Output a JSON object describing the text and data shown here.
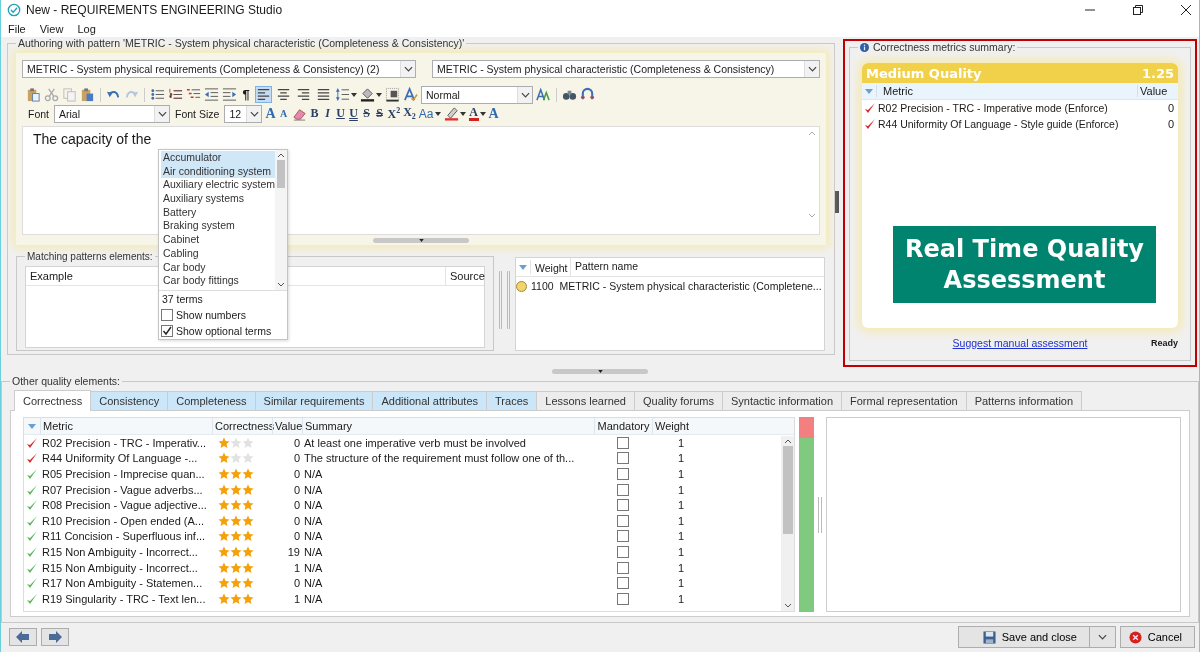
{
  "window": {
    "title": "New - REQUIREMENTS ENGINEERING Studio"
  },
  "menu": [
    "File",
    "View",
    "Log"
  ],
  "authoring": {
    "legend": "Authoring with pattern 'METRIC - System physical characteristic (Completeness & Consistency)'",
    "pattern_select": "METRIC - System physical requirements (Completeness & Consistency)  (2)",
    "characteristic_select": "METRIC - System physical characteristic (Completeness & Consistency)",
    "paragraph_mark": "¶",
    "alignment": [
      {
        "selected": true
      },
      {
        "selected": false
      },
      {
        "selected": false
      },
      {
        "selected": false
      }
    ],
    "style_select": "Normal",
    "font_label": "Font",
    "font_select": "Arial",
    "size_label": "Font Size",
    "size_select": "12",
    "format_buttons": [
      {
        "label": "A",
        "kind": "grow"
      },
      {
        "label": "A",
        "kind": "shrink"
      },
      {
        "label": "B",
        "kind": "bold"
      },
      {
        "label": "I",
        "kind": "italic"
      },
      {
        "label": "U",
        "kind": "underline"
      },
      {
        "label": "U",
        "kind": "double-underline"
      },
      {
        "label": "S",
        "kind": "strike"
      },
      {
        "label": "S",
        "kind": "double-strike"
      },
      {
        "label": "X$^{2}$",
        "kind": "super"
      },
      {
        "label": "X$_{2}$",
        "kind": "sub"
      },
      {
        "label": "Aa",
        "kind": "case"
      },
      {
        "label": "A",
        "kind": "color"
      },
      {
        "label": "A",
        "kind": "effect"
      }
    ],
    "text": "The capacity of the"
  },
  "suggestions": {
    "items": [
      {
        "label": "Accumulator",
        "selected": true
      },
      {
        "label": "Air conditioning system",
        "selected": true
      },
      {
        "label": "Auxiliary electric system",
        "selected": false
      },
      {
        "label": "Auxiliary systems",
        "selected": false
      },
      {
        "label": "Battery",
        "selected": false
      },
      {
        "label": "Braking system",
        "selected": false
      },
      {
        "label": "Cabinet",
        "selected": false
      },
      {
        "label": "Cabling",
        "selected": false
      },
      {
        "label": "Car body",
        "selected": false
      },
      {
        "label": "Car body fittings",
        "selected": false
      }
    ],
    "count": "37 terms",
    "options": [
      {
        "label": "Show numbers",
        "checked": false
      },
      {
        "label": "Show optional terms",
        "checked": true
      }
    ]
  },
  "matching": {
    "legend": "Matching patterns elements:",
    "columns": [
      "Example",
      "Source"
    ]
  },
  "patterns": {
    "columns": [
      "Weight",
      "Pattern name"
    ],
    "rows": [
      {
        "color": "#f3d36b",
        "weight": "1100",
        "name": "METRIC - System physical characteristic (Completene..."
      }
    ]
  },
  "summary": {
    "legend": "Correctness metrics summary:",
    "quality": "Medium Quality",
    "score": "1.25",
    "columns": [
      "Metric",
      "Value"
    ],
    "rows": [
      {
        "color": "#d42a2a",
        "metric": "R02 Precision - TRC - Imperative mode (Enforce)",
        "value": "0"
      },
      {
        "color": "#d42a2a",
        "metric": "R44 Uniformity Of Language - Style guide (Enforce)",
        "value": "0"
      }
    ],
    "banner": "Real Time Quality Assessment",
    "link": "Suggest manual assessment",
    "status": "Ready"
  },
  "quality": {
    "legend": "Other quality elements:",
    "tabs": [
      {
        "label": "Correctness",
        "selected": true,
        "highlighted": false
      },
      {
        "label": "Consistency",
        "selected": false,
        "highlighted": true
      },
      {
        "label": "Completeness",
        "selected": false,
        "highlighted": true
      },
      {
        "label": "Similar requirements",
        "selected": false,
        "highlighted": true
      },
      {
        "label": "Additional attributes",
        "selected": false,
        "highlighted": true
      },
      {
        "label": "Traces",
        "selected": false,
        "highlighted": true
      },
      {
        "label": "Lessons learned",
        "selected": false,
        "highlighted": false
      },
      {
        "label": "Quality forums",
        "selected": false,
        "highlighted": false
      },
      {
        "label": "Syntactic information",
        "selected": false,
        "highlighted": false
      },
      {
        "label": "Formal representation",
        "selected": false,
        "highlighted": false
      },
      {
        "label": "Patterns information",
        "selected": false,
        "highlighted": false
      }
    ],
    "columns": [
      "Metric",
      "Correctness",
      "Value",
      "Summary",
      "Mandatory",
      "Weight"
    ],
    "rows": [
      {
        "color": "#d42a2a",
        "metric": "R02 Precision - TRC - Imperativ...",
        "stars": 1,
        "value": "0",
        "summary": "At least one imperative verb must be involved",
        "mandatory": false,
        "weight": "1"
      },
      {
        "color": "#d42a2a",
        "metric": "R44 Uniformity Of Language -...",
        "stars": 1,
        "value": "0",
        "summary": "The structure of the requirement must follow one of th...",
        "mandatory": false,
        "weight": "1"
      },
      {
        "color": "#5cb85c",
        "metric": "R05 Precision - Imprecise quan...",
        "stars": 3,
        "value": "0",
        "summary": "N/A",
        "mandatory": false,
        "weight": "1"
      },
      {
        "color": "#5cb85c",
        "metric": "R07 Precision - Vague adverbs...",
        "stars": 3,
        "value": "0",
        "summary": "N/A",
        "mandatory": false,
        "weight": "1"
      },
      {
        "color": "#5cb85c",
        "metric": "R08 Precision - Vague adjective...",
        "stars": 3,
        "value": "0",
        "summary": "N/A",
        "mandatory": false,
        "weight": "1"
      },
      {
        "color": "#5cb85c",
        "metric": "R10 Precision - Open ended (A...",
        "stars": 3,
        "value": "0",
        "summary": "N/A",
        "mandatory": false,
        "weight": "1"
      },
      {
        "color": "#5cb85c",
        "metric": "R11 Concision - Superfluous inf...",
        "stars": 3,
        "value": "0",
        "summary": "N/A",
        "mandatory": false,
        "weight": "1"
      },
      {
        "color": "#5cb85c",
        "metric": "R15 Non Ambiguity - Incorrect...",
        "stars": 3,
        "value": "19",
        "summary": "N/A",
        "mandatory": false,
        "weight": "1"
      },
      {
        "color": "#5cb85c",
        "metric": "R15 Non Ambiguity - Incorrect...",
        "stars": 3,
        "value": "1",
        "summary": "N/A",
        "mandatory": false,
        "weight": "1"
      },
      {
        "color": "#5cb85c",
        "metric": "R17 Non Ambiguity - Statemen...",
        "stars": 3,
        "value": "0",
        "summary": "N/A",
        "mandatory": false,
        "weight": "1"
      },
      {
        "color": "#5cb85c",
        "metric": "R19 Singularity - TRC - Text len...",
        "stars": 3,
        "value": "1",
        "summary": "N/A",
        "mandatory": false,
        "weight": "1"
      }
    ],
    "bar": {
      "level": 0.89
    }
  },
  "footer": {
    "save": "Save and close",
    "cancel": "Cancel"
  }
}
